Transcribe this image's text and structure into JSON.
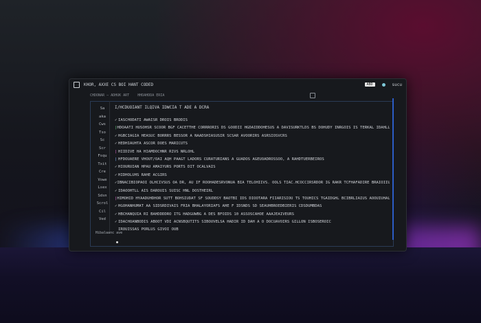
{
  "window": {
    "title": "KHOR, AXXE CS BOI HANT CODED",
    "badge": "ABD",
    "right_label": "sucu"
  },
  "toolbar": {
    "item1": "CHDONAR — ADHUK ART",
    "item2": "HHDAHDDA ERIA"
  },
  "gutter": [
    "Sa",
    "aka",
    "Cws",
    "Tso",
    "Sc",
    "Scr",
    "Fsqu",
    "Txit",
    "Cre",
    "Vowe",
    "Lsex",
    "Sdsn",
    "Scrol",
    "Cil",
    "Ved"
  ],
  "code_header": "I/HCDUOIANT   ILQIVA IDWCIA T ADE A   DCRA",
  "code_lines": [
    {
      "mark": "✓",
      "cls": "",
      "text": "IASCHODATI AWAISR DROIS BRODIS"
    },
    {
      "mark": "|",
      "cls": "green",
      "text": "HDOAATI HUSOHSR SCOOR BGF CACETTHE CORRRORIS DS GOODII HGDAIDDOHESUS A DAVISURKTLDS BS DOHUDY INRGOIS IS TERKAL IDAHLLDUCA TUDD"
    },
    {
      "mark": "✓",
      "cls": "",
      "text": "HGBCIAGIA HEASUC BORRRS BESSOR A NAADSHIASUSIR SCSAR AVOORIRS   ASRSIOSVCRS"
    },
    {
      "mark": "✓",
      "cls": "",
      "text": "HEDHIAUHTA ASCOR DOES MARICUTS"
    },
    {
      "mark": "|",
      "cls": "pink",
      "text": "HIIDIVE HA HIAMDOCHNR RIVS  NRLOHL"
    },
    {
      "mark": "|",
      "cls": "blue",
      "text": "HFDOUAERE VHOUT/OAI AQH PAAGT LADORS CURATURIANS A GUADOS AGEUOADROSSOO, A RAHDTUERBEIROS"
    },
    {
      "mark": "✓",
      "cls": "",
      "text": "HIOURUIAN HPAU AMAIYURS PORTS DIT OCALVAIS"
    },
    {
      "mark": "✓",
      "cls": "",
      "text": "HIDHOLUHS RAHE ACGIRS"
    },
    {
      "mark": "✓",
      "cls": "",
      "text": "IBNACIBIOPAOI OLHCIVSUS OA DR, AU IF ROOHADESRVONUA  BIA TELOHIIVS. OOLS TIAC.HCOCCIRSRDOR IG RAKR TCFHAFADIRE  BRAIOIIUSIIS"
    },
    {
      "mark": "✓",
      "cls": "",
      "text": "IDAOOHTLL AIS DAROUIS SUISC HNL DOSTHEIRL"
    },
    {
      "mark": "|",
      "cls": "pink",
      "text": "HIMOHID HYAADUHDHOR  SUTT BOHSIUDAT SF SOUDDSY  BAOTBI IDS DIOOTARA FIIARISIOU TS TOUHICS TGAIDGHL BCIBRLIAIUS AOOUIUHAL, EADLIS DRWSBIF"
    },
    {
      "mark": "✓",
      "cls": "",
      "text": "HGOHANHUMAT AA SIDSRDIVAIS FRIA BHALAYORIAFS AHE F  IDSNDS  SD  SEAUHBROEDBIERIS  CDSDUMBDAS"
    },
    {
      "mark": "✓",
      "cls": "",
      "text": "HBCHANQUIA RI BAHDDDDRO ITG HADGUWBG A DES BFOIDS 10    ASSOSCAHOE AAAJEAIVEURS"
    },
    {
      "mark": "✓",
      "cls": "",
      "text": "IDACHOANBODIS ABOOT VDI ACNSBQUTITS SIBOUVELSA HADIR ID DAH A O DOCUAVOIRS GILLON ISBOSEROIC"
    },
    {
      "mark": "",
      "cls": "",
      "text": "IROUISSAS PORLUS GIVOI   OUB"
    }
  ],
  "statusbar": "Hibalaanc  ave"
}
